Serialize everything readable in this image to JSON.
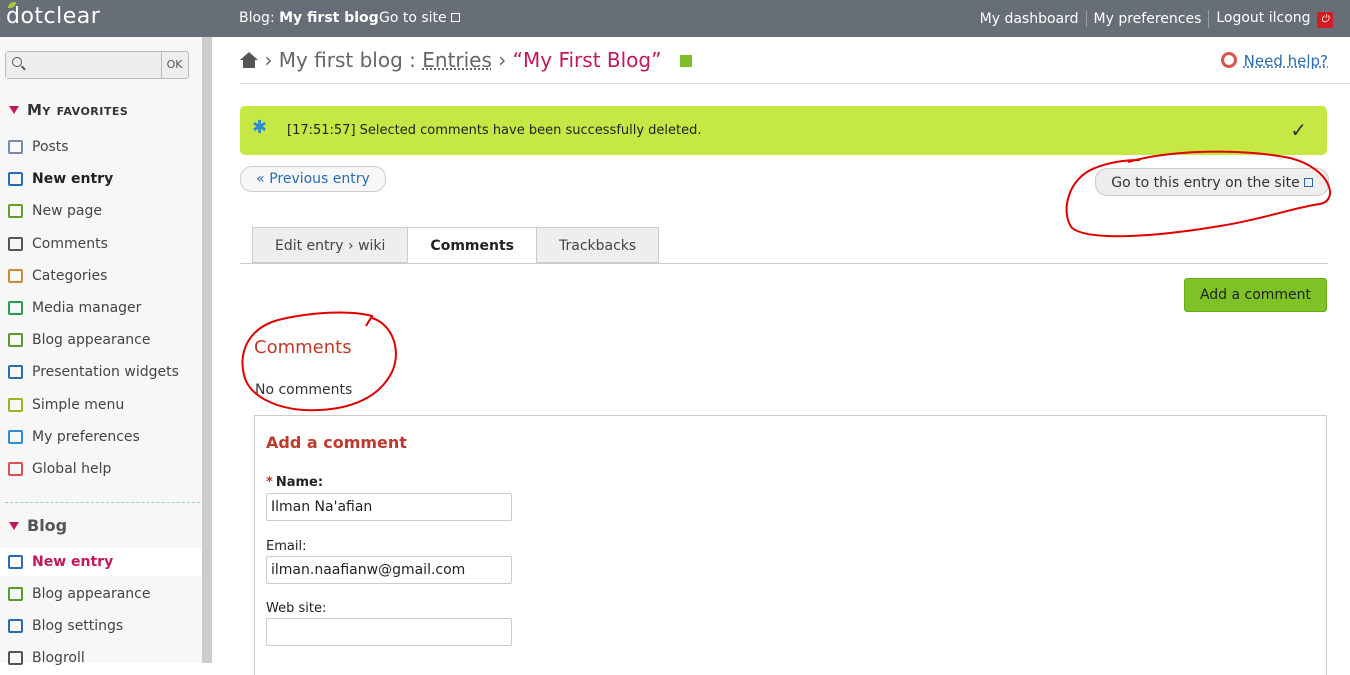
{
  "topbar": {
    "logo": "dotclear",
    "blog_prefix": "Blog: ",
    "blog_name": "My first blog",
    "go_to_site": "Go to site",
    "my_dashboard": "My dashboard",
    "my_preferences": "My preferences",
    "logout": "Logout ilcong"
  },
  "sidebar": {
    "search_placeholder": "",
    "search_ok": "OK",
    "favorites_title": "My favorites",
    "favorites": [
      {
        "label": "Posts",
        "icon": "posts-icon",
        "color": "#7a8aa0"
      },
      {
        "label": "New entry",
        "icon": "new-entry-icon",
        "color": "#2a6cb0"
      },
      {
        "label": "New page",
        "icon": "new-page-icon",
        "color": "#6a9a2a"
      },
      {
        "label": "Comments",
        "icon": "comments-icon",
        "color": "#555"
      },
      {
        "label": "Categories",
        "icon": "categories-icon",
        "color": "#c98a3a"
      },
      {
        "label": "Media manager",
        "icon": "media-icon",
        "color": "#2a9a5a"
      },
      {
        "label": "Blog appearance",
        "icon": "appearance-icon",
        "color": "#5a9a2a"
      },
      {
        "label": "Presentation widgets",
        "icon": "widgets-icon",
        "color": "#2a6cb0"
      },
      {
        "label": "Simple menu",
        "icon": "menu-icon",
        "color": "#a0b020"
      },
      {
        "label": "My preferences",
        "icon": "user-icon",
        "color": "#2a8bd8"
      },
      {
        "label": "Global help",
        "icon": "help-icon",
        "color": "#d9534f"
      }
    ],
    "blog_title": "Blog",
    "blog_items": [
      {
        "label": "New entry",
        "icon": "new-entry-icon",
        "color": "#2a6cb0"
      },
      {
        "label": "Blog appearance",
        "icon": "appearance-icon",
        "color": "#5a9a2a"
      },
      {
        "label": "Blog settings",
        "icon": "settings-icon",
        "color": "#2a6cb0"
      },
      {
        "label": "Blogroll",
        "icon": "blogroll-icon",
        "color": "#555"
      }
    ]
  },
  "breadcrumb": {
    "blog": "My first blog",
    "sep1": " : ",
    "entries": "Entries",
    "sep2": " › ",
    "title": "“My First Blog”"
  },
  "help": "Need help?",
  "message": "[17:51:57] Selected comments have been successfully deleted.",
  "prev_entry": "« Previous entry",
  "go_entry_site": "Go to this entry on the site",
  "tabs": [
    "Edit entry › wiki",
    "Comments",
    "Trackbacks"
  ],
  "add_comment_button": "Add a comment",
  "comments_heading": "Comments",
  "no_comments": "No comments",
  "form": {
    "title": "Add a comment",
    "name_label": "Name:",
    "name_value": "Ilman Na'afian",
    "email_label": "Email:",
    "email_value": "ilman.naafianw@gmail.com",
    "website_label": "Web site:",
    "website_value": ""
  },
  "colors": {
    "accent": "#c2185b",
    "success": "#c5e845",
    "button_green": "#7ec226",
    "annotation": "#e00000"
  }
}
